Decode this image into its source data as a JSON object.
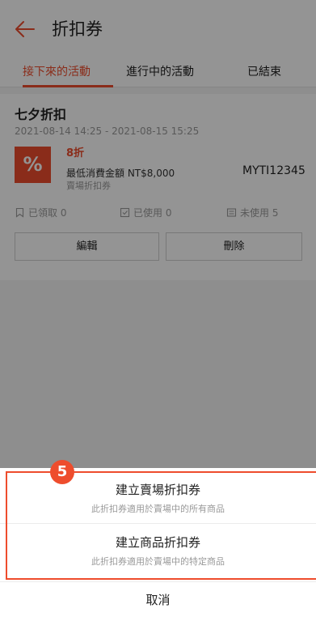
{
  "header": {
    "title": "折扣券"
  },
  "tabs": [
    {
      "label": "接下來的活動",
      "active": true
    },
    {
      "label": "進行中的活動",
      "active": false
    },
    {
      "label": "已結束",
      "active": false
    }
  ],
  "voucher": {
    "name": "七夕折扣",
    "period": "2021-08-14 14:25 - 2021-08-15 15:25",
    "badge_symbol": "%",
    "discount": "8折",
    "min_spend": "最低消費金額 NT$8,000",
    "type": "賣場折扣券",
    "code": "MYTI12345",
    "stats": {
      "claimed": "已領取 0",
      "used": "已使用 0",
      "unused": "未使用 5"
    },
    "edit_label": "編輯",
    "delete_label": "刪除"
  },
  "sheet": {
    "step_marker": "5",
    "options": [
      {
        "title": "建立賣場折扣券",
        "subtitle": "此折扣券適用於賣場中的所有商品"
      },
      {
        "title": "建立商品折扣券",
        "subtitle": "此折扣券適用於賣場中的特定商品"
      }
    ],
    "cancel_label": "取消"
  },
  "colors": {
    "accent": "#ee4d2d",
    "overlay": "rgba(0,0,0,0.42)"
  }
}
